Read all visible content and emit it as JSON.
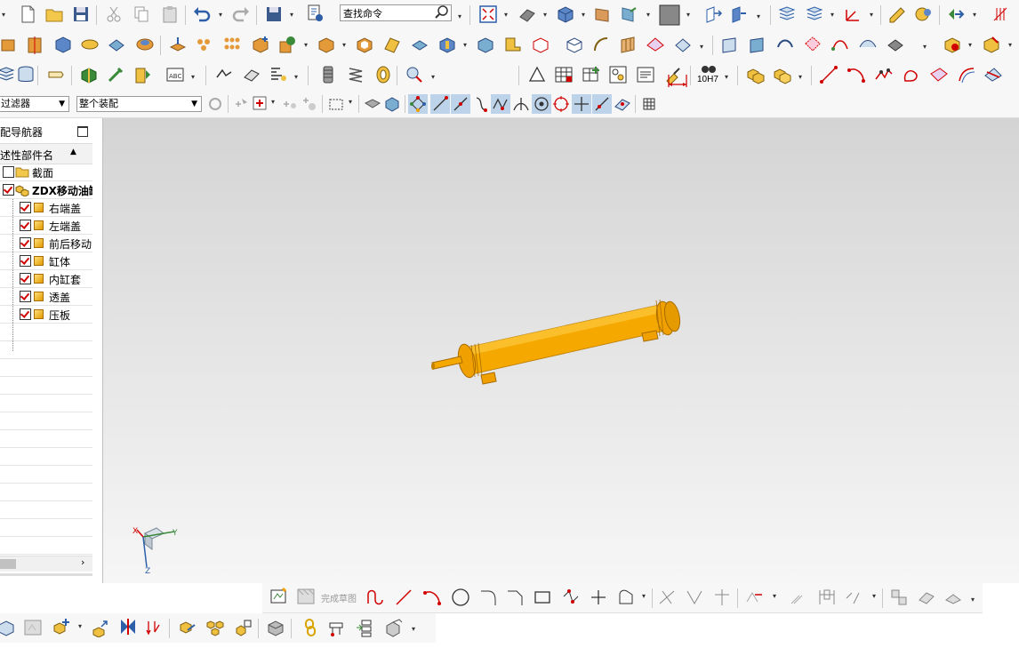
{
  "search": {
    "placeholder": "查找命令"
  },
  "selection_bar": {
    "filter_label": "过滤器",
    "scope_label": "整个装配"
  },
  "navigator": {
    "title": "配导航器",
    "column_header": "述性部件名",
    "items": [
      {
        "label": "截面",
        "checked": false,
        "type": "folder"
      },
      {
        "label": "ZDX移动油缸",
        "checked": true,
        "type": "assembly"
      },
      {
        "label": "右端盖",
        "checked": true,
        "type": "part"
      },
      {
        "label": "左端盖",
        "checked": true,
        "type": "part"
      },
      {
        "label": "前后移动",
        "checked": true,
        "type": "part"
      },
      {
        "label": "缸体",
        "checked": true,
        "type": "part"
      },
      {
        "label": "内缸套",
        "checked": true,
        "type": "part"
      },
      {
        "label": "透盖",
        "checked": true,
        "type": "part"
      },
      {
        "label": "压板",
        "checked": true,
        "type": "part"
      }
    ]
  },
  "sketch_toolbar": {
    "finish_label": "完成草图"
  },
  "toolbar_icons": {
    "tolerance_label": "10H7"
  },
  "triad": {
    "x_label": "X",
    "y_label": "Y",
    "z_label": "Z"
  },
  "colors": {
    "model_body": "#f5a800",
    "model_shadow": "#c27f00",
    "accent_red": "#d10000"
  }
}
